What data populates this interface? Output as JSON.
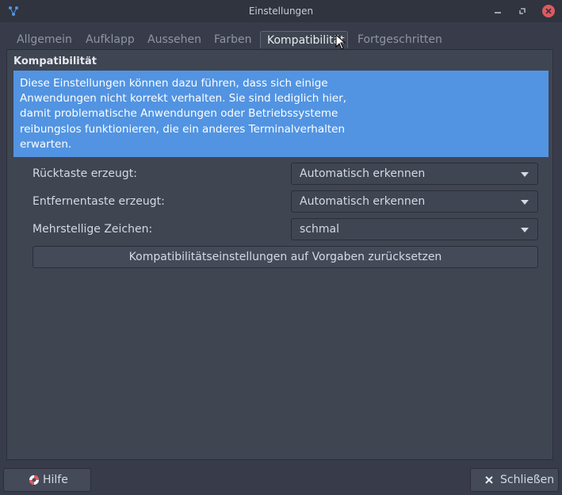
{
  "window": {
    "title": "Einstellungen"
  },
  "tabs": [
    {
      "label": "Allgemein",
      "active": false
    },
    {
      "label": "Aufklapp",
      "active": false
    },
    {
      "label": "Aussehen",
      "active": false
    },
    {
      "label": "Farben",
      "active": false
    },
    {
      "label": "Kompatibilität",
      "active": true
    },
    {
      "label": "Fortgeschritten",
      "active": false
    }
  ],
  "section": {
    "title": "Kompatibilität",
    "info_lines": [
      "Diese Einstellungen können dazu führen, dass sich einige",
      "Anwendungen nicht korrekt verhalten. Sie sind lediglich hier,",
      "damit problematische Anwendungen oder Betriebssysteme",
      "reibungslos funktionieren, die ein anderes Terminalverhalten",
      "erwarten."
    ]
  },
  "settings": [
    {
      "label": "Rücktaste erzeugt:",
      "value": "Automatisch erkennen"
    },
    {
      "label": "Entfernentaste erzeugt:",
      "value": "Automatisch erkennen"
    },
    {
      "label": "Mehrstellige Zeichen:",
      "value": "schmal"
    }
  ],
  "reset_button": "Kompatibilitätseinstellungen auf Vorgaben zurücksetzen",
  "footer": {
    "help_label": "Hilfe",
    "close_label": "Schließen"
  },
  "colors": {
    "background": "#383c4a",
    "titlebar": "#2f343f",
    "accent": "#5294e2",
    "close_button": "#e0595e"
  }
}
